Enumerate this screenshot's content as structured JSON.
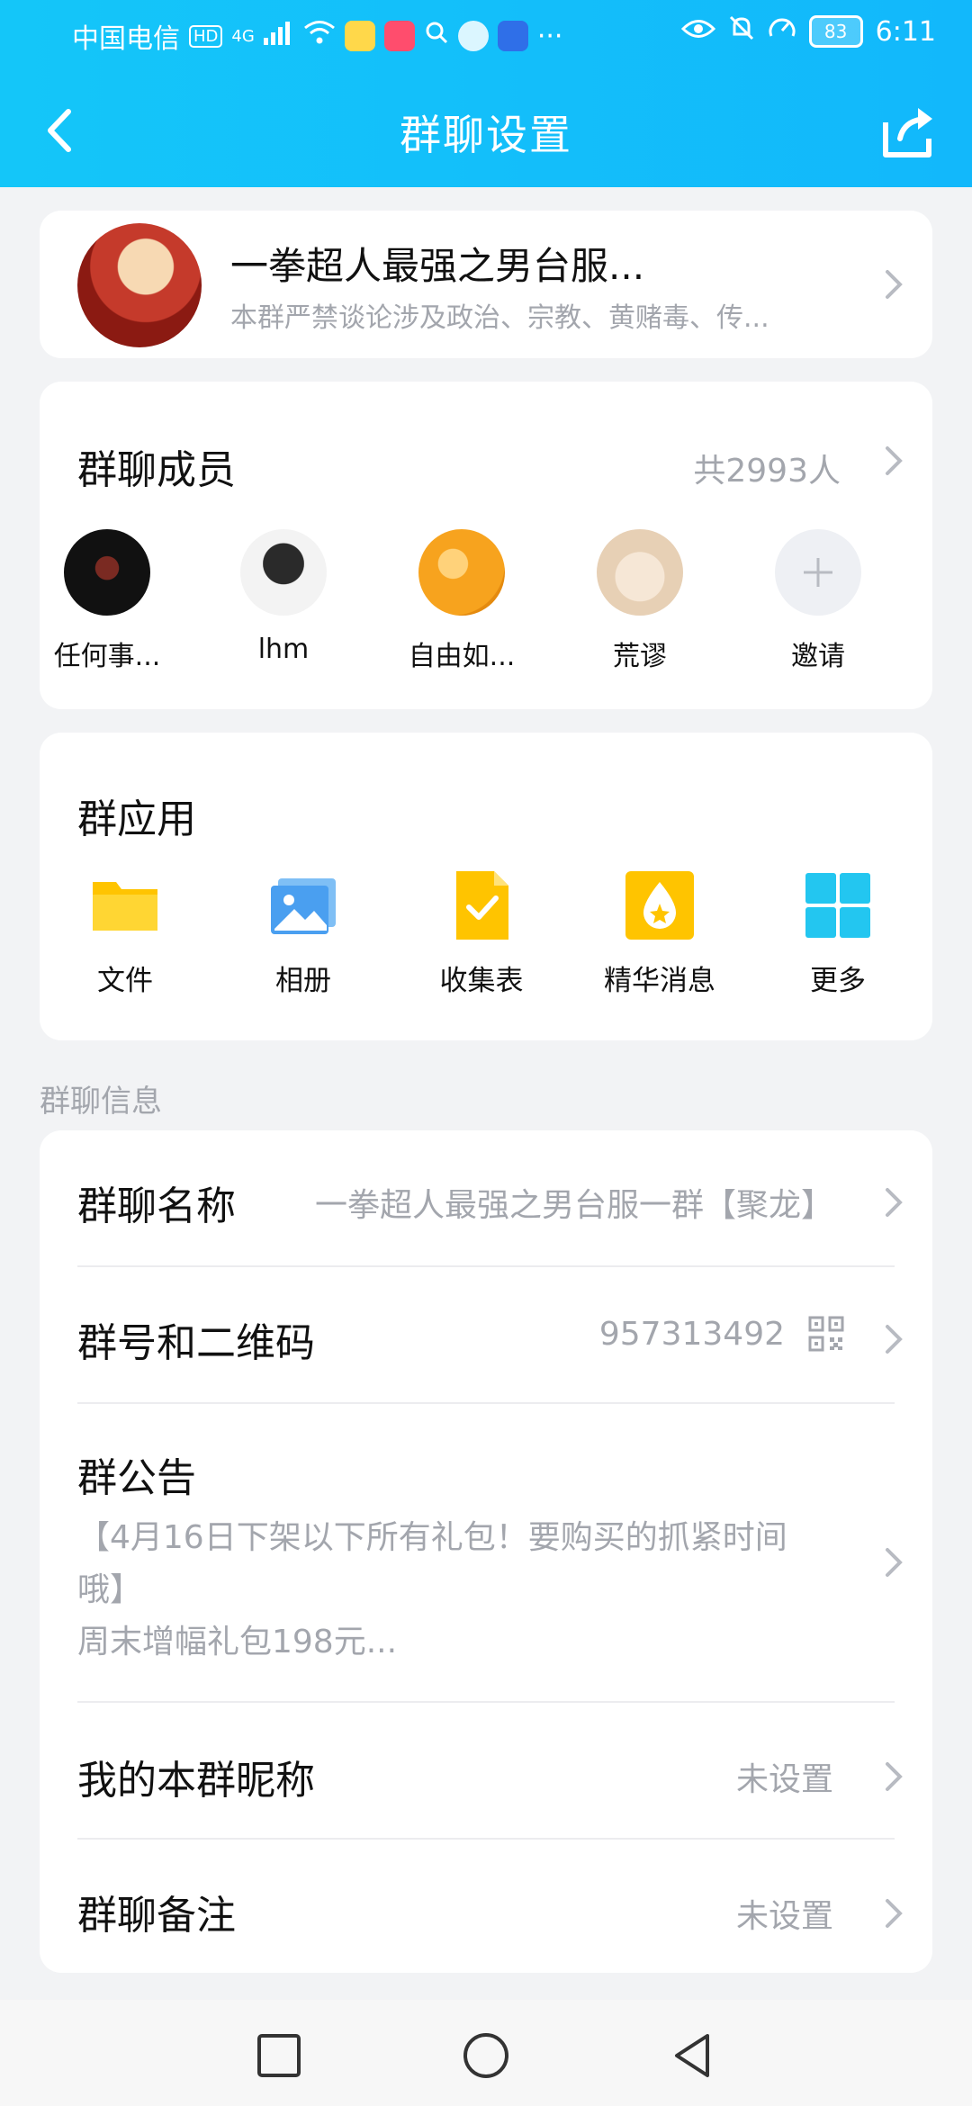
{
  "status_bar": {
    "carrier": "中国电信",
    "hd": "HD",
    "network": "4G",
    "battery": "83",
    "time": "6:11"
  },
  "nav": {
    "title": "群聊设置",
    "back_icon": "chevron-left-icon",
    "share_icon": "share-icon"
  },
  "group": {
    "name": "一拳超人最强之男台服...",
    "description": "本群严禁谈论涉及政治、宗教、黄赌毒、传..."
  },
  "members": {
    "title": "群聊成员",
    "count": "共2993人",
    "list": [
      {
        "name": "任何事..."
      },
      {
        "name": "lhm"
      },
      {
        "name": "自由如..."
      },
      {
        "name": "荒谬"
      },
      {
        "name": "邀请"
      }
    ]
  },
  "apps": {
    "title": "群应用",
    "items": [
      {
        "label": "文件",
        "icon": "folder-icon"
      },
      {
        "label": "相册",
        "icon": "album-icon"
      },
      {
        "label": "收集表",
        "icon": "form-icon"
      },
      {
        "label": "精华消息",
        "icon": "essence-icon"
      },
      {
        "label": "更多",
        "icon": "grid-icon"
      }
    ]
  },
  "info": {
    "section_label": "群聊信息",
    "name_label": "群聊名称",
    "name_value": "一拳超人最强之男台服一群【聚龙】",
    "number_label": "群号和二维码",
    "number_value": "957313492",
    "notice_label": "群公告",
    "notice_line1": "【4月16日下架以下所有礼包！要购买的抓紧时间",
    "notice_line2": "哦】",
    "notice_line3": "周末增幅礼包198元...",
    "nickname_label": "我的本群昵称",
    "nickname_value": "未设置",
    "remark_label": "群聊备注",
    "remark_value": "未设置"
  },
  "colors": {
    "header": "#14c6f9",
    "background": "#f2f3f5",
    "secondary_text": "#a3a6ad"
  }
}
